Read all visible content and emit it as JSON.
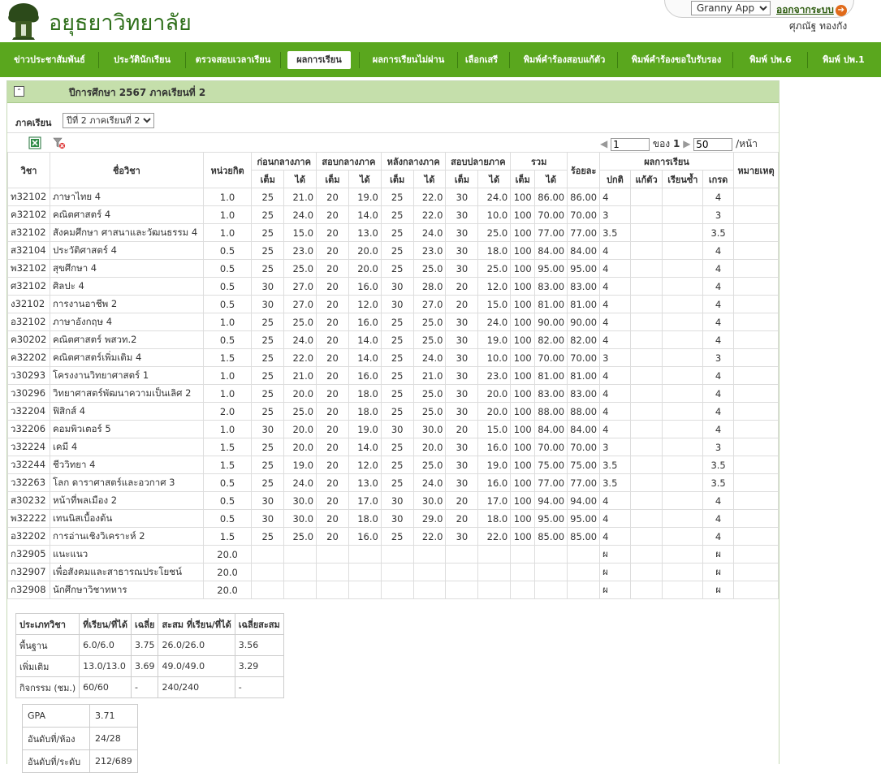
{
  "header": {
    "site_title": "อยุธยาวิทยาลัย",
    "user_select_value": "Granny Apple",
    "logout_label": "ออกจากระบบ",
    "username": "ศุภณัฐ  ทองกัง"
  },
  "nav": {
    "items": [
      {
        "label": "ข่าวประชาสัมพันธ์"
      },
      {
        "label": "ประวัตินักเรียน"
      },
      {
        "label": "ตรวจสอบเวลาเรียน"
      },
      {
        "label": "ผลการเรียน",
        "active": true
      },
      {
        "label": "ผลการเรียนไม่ผ่าน"
      },
      {
        "label": "เลือกเสรี"
      },
      {
        "label": "พิมพ์คำร้องสอบแก้ตัว"
      },
      {
        "label": "พิมพ์คำร้องขอใบรับรอง"
      },
      {
        "label": "พิมพ์ ปพ.6"
      },
      {
        "label": "พิมพ์ ปพ.1"
      }
    ]
  },
  "panel": {
    "title": "ปีการศึกษา  2567  ภาคเรียนที่  2",
    "term_label": "ภาคเรียน",
    "term_value": "ปีที่ 2 ภาคเรียนที่ 2"
  },
  "pager": {
    "page": "1",
    "of_label": "ของ",
    "total_pages": "1",
    "per_page": "50",
    "per_page_suffix": "/หน้า"
  },
  "table": {
    "headers": {
      "code": "วิชา",
      "name": "ชื่อวิชา",
      "credit": "หน่วยกิต",
      "before_mid": "ก่อนกลางภาค",
      "mid": "สอบกลางภาค",
      "after_mid": "หลังกลางภาค",
      "final": "สอบปลายภาค",
      "total": "รวม",
      "percent": "ร้อยละ",
      "result": "ผลการเรียน",
      "note": "หมายเหตุ",
      "full": "เต็ม",
      "got": "ได้",
      "normal": "ปกติ",
      "remedial": "แก้ตัว",
      "repeat": "เรียนซ้ำ",
      "grade": "เกรด"
    },
    "rows": [
      [
        "ท32102",
        "ภาษาไทย  4",
        "1.0",
        "25",
        "21.0",
        "20",
        "19.0",
        "25",
        "22.0",
        "30",
        "24.0",
        "100",
        "86.00",
        "86.00",
        "4",
        "",
        "",
        "4",
        ""
      ],
      [
        "ค32102",
        "คณิตศาสตร์  4",
        "1.0",
        "25",
        "24.0",
        "20",
        "14.0",
        "25",
        "22.0",
        "30",
        "10.0",
        "100",
        "70.00",
        "70.00",
        "3",
        "",
        "",
        "3",
        ""
      ],
      [
        "ส32102",
        "สังคมศึกษา  ศาสนาและวัฒนธรรม  4",
        "1.0",
        "25",
        "15.0",
        "20",
        "13.0",
        "25",
        "24.0",
        "30",
        "25.0",
        "100",
        "77.00",
        "77.00",
        "3.5",
        "",
        "",
        "3.5",
        ""
      ],
      [
        "ส32104",
        "ประวัติศาสตร์  4",
        "0.5",
        "25",
        "23.0",
        "20",
        "20.0",
        "25",
        "23.0",
        "30",
        "18.0",
        "100",
        "84.00",
        "84.00",
        "4",
        "",
        "",
        "4",
        ""
      ],
      [
        "พ32102",
        "สุขศึกษา  4",
        "0.5",
        "25",
        "25.0",
        "20",
        "20.0",
        "25",
        "25.0",
        "30",
        "25.0",
        "100",
        "95.00",
        "95.00",
        "4",
        "",
        "",
        "4",
        ""
      ],
      [
        "ศ32102",
        "ศิลปะ  4",
        "0.5",
        "30",
        "27.0",
        "20",
        "16.0",
        "30",
        "28.0",
        "20",
        "12.0",
        "100",
        "83.00",
        "83.00",
        "4",
        "",
        "",
        "4",
        ""
      ],
      [
        "ง32102",
        "การงานอาชีพ  2",
        "0.5",
        "30",
        "27.0",
        "20",
        "12.0",
        "30",
        "27.0",
        "20",
        "15.0",
        "100",
        "81.00",
        "81.00",
        "4",
        "",
        "",
        "4",
        ""
      ],
      [
        "อ32102",
        "ภาษาอังกฤษ  4",
        "1.0",
        "25",
        "25.0",
        "20",
        "16.0",
        "25",
        "25.0",
        "30",
        "24.0",
        "100",
        "90.00",
        "90.00",
        "4",
        "",
        "",
        "4",
        ""
      ],
      [
        "ค30202",
        "คณิตศาสตร์  พสวท.2",
        "0.5",
        "25",
        "24.0",
        "20",
        "14.0",
        "25",
        "25.0",
        "30",
        "19.0",
        "100",
        "82.00",
        "82.00",
        "4",
        "",
        "",
        "4",
        ""
      ],
      [
        "ค32202",
        "คณิตศาสตร์เพิ่มเติม  4",
        "1.5",
        "25",
        "22.0",
        "20",
        "14.0",
        "25",
        "24.0",
        "30",
        "10.0",
        "100",
        "70.00",
        "70.00",
        "3",
        "",
        "",
        "3",
        ""
      ],
      [
        "ว30293",
        "โครงงานวิทยาศาสตร์  1",
        "1.0",
        "25",
        "21.0",
        "20",
        "16.0",
        "25",
        "21.0",
        "30",
        "23.0",
        "100",
        "81.00",
        "81.00",
        "4",
        "",
        "",
        "4",
        ""
      ],
      [
        "ว30296",
        "วิทยาศาสตร์พัฒนาความเป็นเลิศ  2",
        "1.0",
        "25",
        "20.0",
        "20",
        "18.0",
        "25",
        "25.0",
        "30",
        "20.0",
        "100",
        "83.00",
        "83.00",
        "4",
        "",
        "",
        "4",
        ""
      ],
      [
        "ว32204",
        "ฟิสิกส์  4",
        "2.0",
        "25",
        "25.0",
        "20",
        "18.0",
        "25",
        "25.0",
        "30",
        "20.0",
        "100",
        "88.00",
        "88.00",
        "4",
        "",
        "",
        "4",
        ""
      ],
      [
        "ว32206",
        "คอมพิวเตอร์  5",
        "1.0",
        "30",
        "20.0",
        "20",
        "19.0",
        "30",
        "30.0",
        "20",
        "15.0",
        "100",
        "84.00",
        "84.00",
        "4",
        "",
        "",
        "4",
        ""
      ],
      [
        "ว32224",
        "เคมี  4",
        "1.5",
        "25",
        "20.0",
        "20",
        "14.0",
        "25",
        "20.0",
        "30",
        "16.0",
        "100",
        "70.00",
        "70.00",
        "3",
        "",
        "",
        "3",
        ""
      ],
      [
        "ว32244",
        "ชีววิทยา  4",
        "1.5",
        "25",
        "19.0",
        "20",
        "12.0",
        "25",
        "25.0",
        "30",
        "19.0",
        "100",
        "75.00",
        "75.00",
        "3.5",
        "",
        "",
        "3.5",
        ""
      ],
      [
        "ว32263",
        "โลก  ดาราศาสตร์และอวกาศ  3",
        "0.5",
        "25",
        "24.0",
        "20",
        "13.0",
        "25",
        "24.0",
        "30",
        "16.0",
        "100",
        "77.00",
        "77.00",
        "3.5",
        "",
        "",
        "3.5",
        ""
      ],
      [
        "ส30232",
        "หน้าที่พลเมือง  2",
        "0.5",
        "30",
        "30.0",
        "20",
        "17.0",
        "30",
        "30.0",
        "20",
        "17.0",
        "100",
        "94.00",
        "94.00",
        "4",
        "",
        "",
        "4",
        ""
      ],
      [
        "พ32222",
        "เทนนิสเบื้องต้น",
        "0.5",
        "30",
        "30.0",
        "20",
        "18.0",
        "30",
        "29.0",
        "20",
        "18.0",
        "100",
        "95.00",
        "95.00",
        "4",
        "",
        "",
        "4",
        ""
      ],
      [
        "อ32202",
        "การอ่านเชิงวิเคราะห์  2",
        "1.5",
        "25",
        "25.0",
        "20",
        "16.0",
        "25",
        "22.0",
        "30",
        "22.0",
        "100",
        "85.00",
        "85.00",
        "4",
        "",
        "",
        "4",
        ""
      ],
      [
        "ก32905",
        "แนะแนว",
        "20.0",
        "",
        "",
        "",
        "",
        "",
        "",
        "",
        "",
        "",
        "",
        "",
        "ผ",
        "",
        "",
        "ผ",
        ""
      ],
      [
        "ก32907",
        "เพื่อสังคมและสาธารณประโยชน์",
        "20.0",
        "",
        "",
        "",
        "",
        "",
        "",
        "",
        "",
        "",
        "",
        "",
        "ผ",
        "",
        "",
        "ผ",
        ""
      ],
      [
        "ก32908",
        "นักศึกษาวิชาทหาร",
        "20.0",
        "",
        "",
        "",
        "",
        "",
        "",
        "",
        "",
        "",
        "",
        "",
        "ผ",
        "",
        "",
        "ผ",
        ""
      ]
    ]
  },
  "summary": {
    "headers": [
      "ประเภทวิชา",
      "ที่เรียน/ที่ได้",
      "เฉลี่ย",
      "สะสม  ที่เรียน/ที่ได้",
      "เฉลี่ยสะสม"
    ],
    "rows": [
      [
        "พื้นฐาน",
        "6.0/6.0",
        "3.75",
        "26.0/26.0",
        "3.56"
      ],
      [
        "เพิ่มเติม",
        "13.0/13.0",
        "3.69",
        "49.0/49.0",
        "3.29"
      ],
      [
        "กิจกรรม  (ชม.)",
        "60/60",
        "-",
        "240/240",
        "-"
      ]
    ]
  },
  "gpa": {
    "rows": [
      [
        "GPA",
        "3.71"
      ],
      [
        "อันดับที่/ห้อง",
        "24/28"
      ],
      [
        "อันดับที่/ระดับ",
        "212/689"
      ]
    ]
  },
  "colors": {
    "nav_green": "#5aa71e",
    "panel_head": "#c5dfab",
    "title_green": "#2f6f1b"
  },
  "icons": {
    "logo": "school-logo-icon",
    "logout": "arrow-right-circle-icon",
    "collapse": "collapse-up-icon",
    "excel": "excel-icon",
    "clear_filter": "clear-filter-icon"
  }
}
